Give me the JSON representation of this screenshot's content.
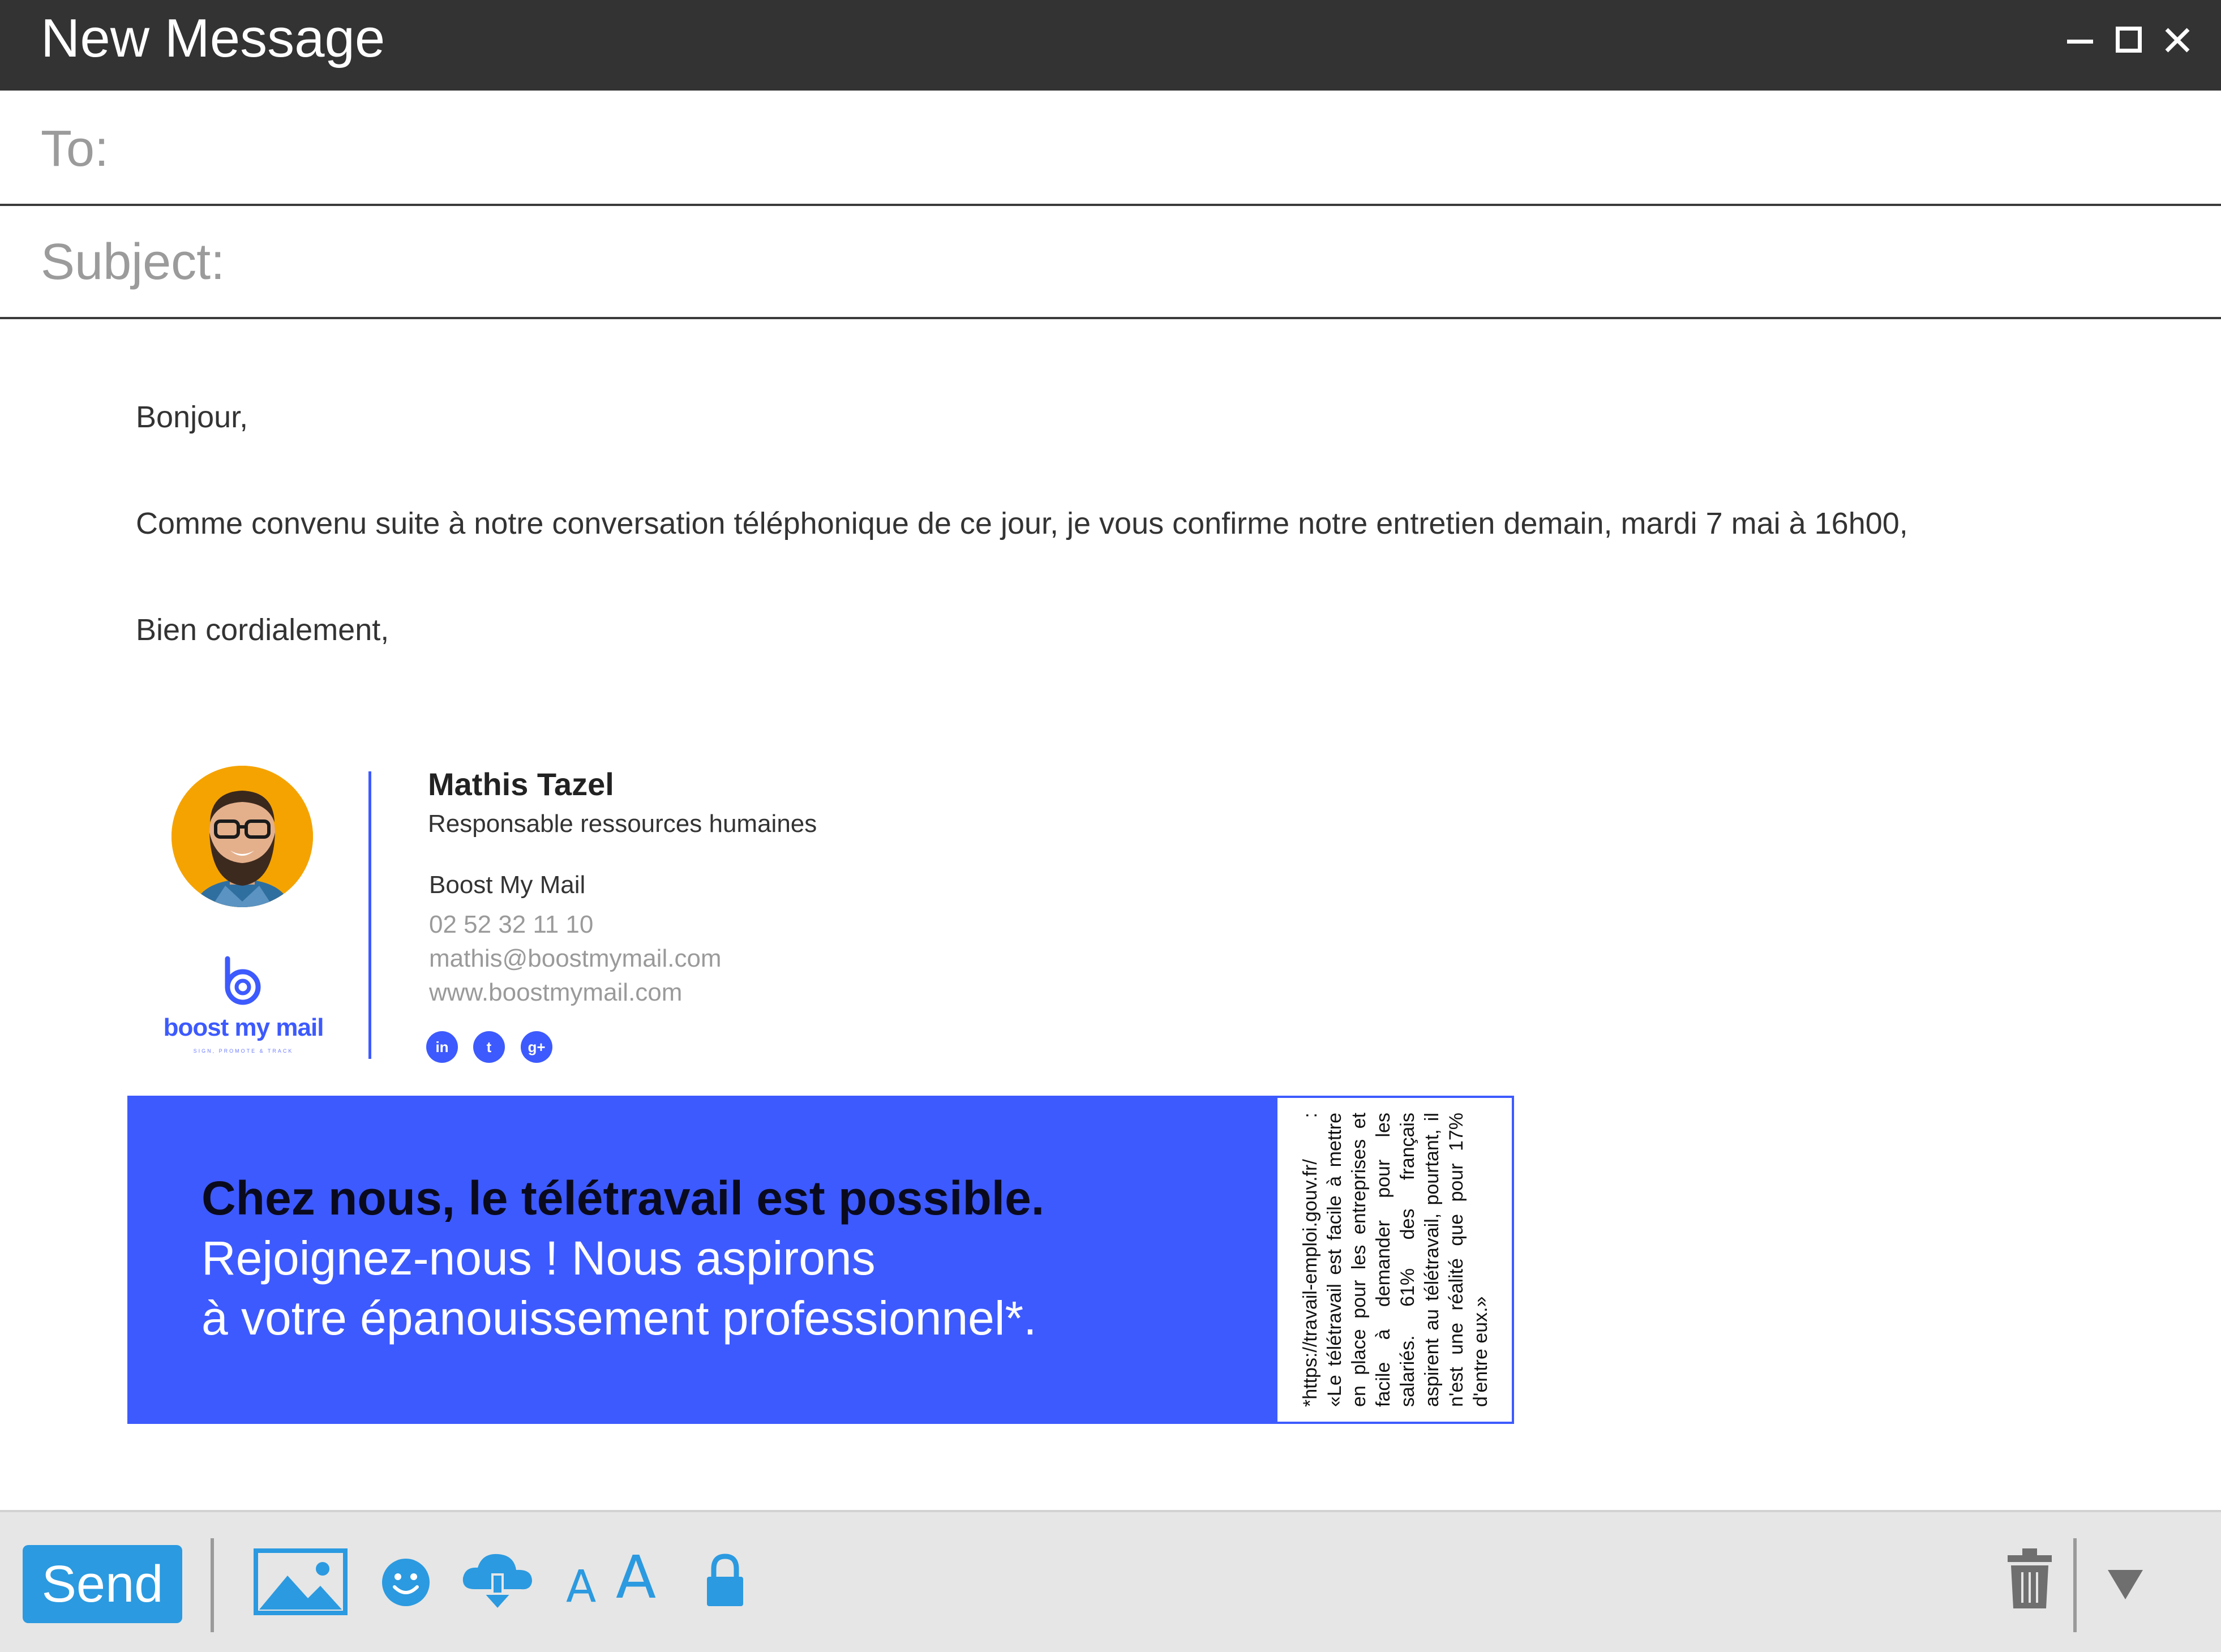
{
  "window": {
    "title": "New Message"
  },
  "fields": {
    "to_label": "To:",
    "to_value": "",
    "subject_label": "Subject:",
    "subject_value": ""
  },
  "body": {
    "greeting": "Bonjour,",
    "main": "Comme convenu suite à notre conversation téléphonique de ce jour, je vous confirme notre entretien demain, mardi 7 mai à 16h00,",
    "closing": "Bien cordialement,"
  },
  "signature": {
    "name": "Mathis Tazel",
    "role": "Responsable ressources humaines",
    "company": "Boost My Mail",
    "phone": "02 52 32 11 10",
    "email": "mathis@boostmymail.com",
    "website": "www.boostmymail.com",
    "logo_text": "boost my mail",
    "logo_tagline": "SIGN, PROMOTE & TRACK",
    "social": [
      {
        "icon": "linkedin-icon",
        "glyph": "in"
      },
      {
        "icon": "twitter-icon",
        "glyph": "t"
      },
      {
        "icon": "google-plus-icon",
        "glyph": "g+"
      }
    ]
  },
  "banner": {
    "headline": "Chez nous, le télétravail est possible.",
    "sub_line_1": "Rejoignez-nous ! Nous aspirons",
    "sub_line_2": "à votre épanouissement professionnel*.",
    "footnote": "*https://travail-emploi.gouv.fr/ : «Le télétravail est facile à mettre en place pour les entreprises et facile à demander pour les salariés. 61% des français aspirent au télétravail, pourtant, il n'est une réalité que pour 17% d'entre eux.»"
  },
  "toolbar": {
    "send_label": "Send",
    "font_small_glyph": "A",
    "font_large_glyph": "A",
    "icons": [
      "image-icon",
      "emoji-icon",
      "cloud-download-icon",
      "font-size-small-icon",
      "font-size-large-icon",
      "lock-icon",
      "trash-icon",
      "more-options-icon"
    ]
  },
  "colors": {
    "titlebar": "#333333",
    "accent_blue": "#3d5afe",
    "toolbar_blue": "#2b9ae0",
    "avatar_bg": "#f5a300",
    "toolbar_bg": "#e6e6e6"
  }
}
